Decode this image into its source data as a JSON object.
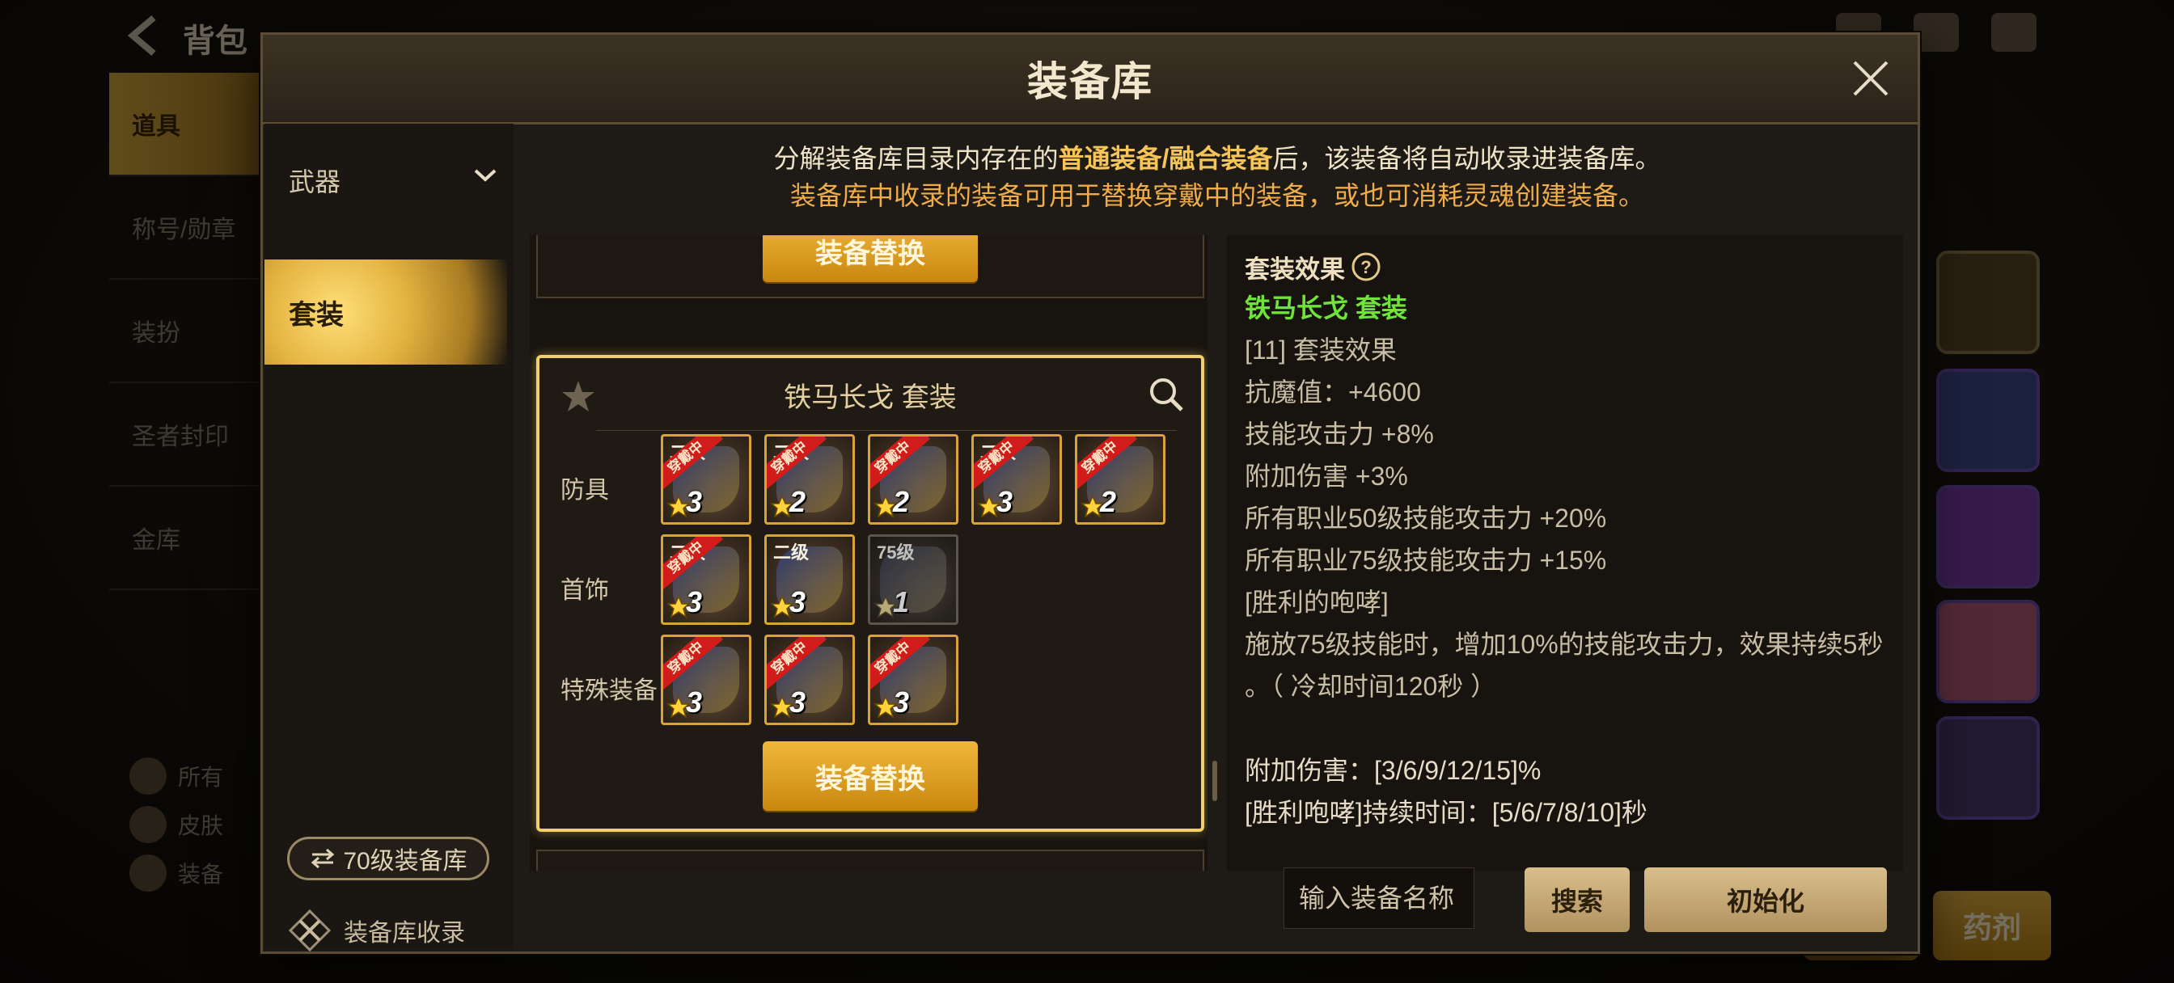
{
  "background": {
    "title": "背包",
    "tabs": [
      "道具",
      "称号/勋章",
      "装扮",
      "圣者封印",
      "金库"
    ],
    "bottom_items": [
      "所有",
      "皮肤",
      "装备"
    ],
    "bottom_buttons": [
      "",
      "药剂"
    ]
  },
  "modal": {
    "title": "装备库",
    "notice_line1_prefix": "分解装备库目录内存在的",
    "notice_line1_highlight": "普通装备/融合装备",
    "notice_line1_suffix": "后，该装备将自动收录进装备库。",
    "notice_line2": "装备库中收录的装备可用于替换穿戴中的装备，或也可消耗灵魂创建装备。"
  },
  "categories": {
    "weapon_label": "武器",
    "set_label": "套装",
    "level_lib_label": "70级装备库",
    "record_label": "装备库收录"
  },
  "set_card": {
    "replace_label": "装备替换",
    "title": "铁马长戈  套装",
    "rows": [
      {
        "label": "防具",
        "items": [
          {
            "badge": "穿戴中",
            "grade": "二级",
            "stars": "3",
            "dim": false
          },
          {
            "badge": "穿戴中",
            "grade": "二级",
            "stars": "2",
            "dim": false
          },
          {
            "badge": "穿戴中",
            "grade": "",
            "stars": "2",
            "dim": false
          },
          {
            "badge": "穿戴中",
            "grade": "二级",
            "stars": "3",
            "dim": false
          },
          {
            "badge": "穿戴中",
            "grade": "",
            "stars": "2",
            "dim": false
          }
        ]
      },
      {
        "label": "首饰",
        "items": [
          {
            "badge": "穿戴中",
            "grade": "二级",
            "stars": "3",
            "dim": false
          },
          {
            "badge": "",
            "grade": "二级",
            "stars": "3",
            "dim": false
          },
          {
            "badge": "",
            "grade": "75级",
            "stars": "1",
            "dim": true
          }
        ]
      },
      {
        "label": "特殊装备",
        "items": [
          {
            "badge": "穿戴中",
            "grade": "",
            "stars": "3",
            "dim": false
          },
          {
            "badge": "穿戴中",
            "grade": "",
            "stars": "3",
            "dim": false
          },
          {
            "badge": "穿戴中",
            "grade": "",
            "stars": "3",
            "dim": false
          }
        ]
      }
    ]
  },
  "detail": {
    "header": "套装效果",
    "set_name": "铁马长戈  套装",
    "lines": [
      "[11] 套装效果",
      "抗魔值：+4600",
      "技能攻击力 +8%",
      "附加伤害 +3%",
      "所有职业50级技能攻击力 +20%",
      "所有职业75级技能攻击力 +15%",
      "[胜利的咆哮]",
      "施放75级技能时，增加10%的技能攻击力，效果持续5秒",
      "。（ 冷却时间120秒 ）",
      "",
      "附加伤害：[3/6/9/12/15]%",
      "[胜利咆哮]持续时间：[5/6/7/8/10]秒"
    ]
  },
  "bottom_bar": {
    "search_placeholder": "输入装备名称",
    "search_label": "搜索",
    "reset_label": "初始化"
  },
  "colors": {
    "accent_gold": "#f0b73c",
    "set_name_green": "#6fe33a",
    "worn_badge_red": "#d21c1c"
  }
}
